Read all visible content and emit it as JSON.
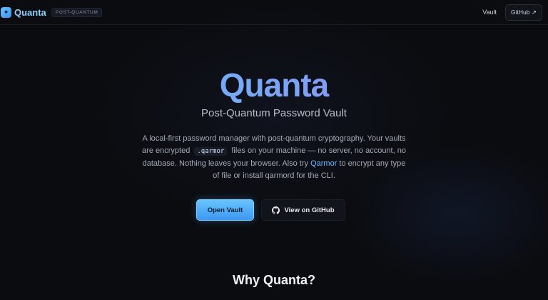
{
  "header": {
    "logo_icon": "sparkle-icon",
    "brand_name": "Quanta",
    "badge": "POST-QUANTUM",
    "nav": {
      "vault_label": "Vault",
      "github_label": "GitHub ↗"
    }
  },
  "hero": {
    "title": "Quanta",
    "subtitle": "Post-Quantum Password Vault",
    "description": {
      "part1": "A local-first password manager with post-quantum cryptography. Your vaults are encrypted",
      "code": ".qarmor",
      "part2": "files on your machine — no server, no account, no database. Nothing leaves your browser. Also try",
      "link": "Qarmor",
      "part3": "to encrypt any type of file or install qarmord for the CLI."
    },
    "primary_button": "Open Vault",
    "secondary_button": "View on GitHub",
    "secondary_button_icon": "github-icon"
  },
  "section": {
    "title": "Why Quanta?"
  },
  "colors": {
    "accent": "#5cc2ff",
    "gradient_end": "#a27af0",
    "background": "#0b0c10"
  }
}
